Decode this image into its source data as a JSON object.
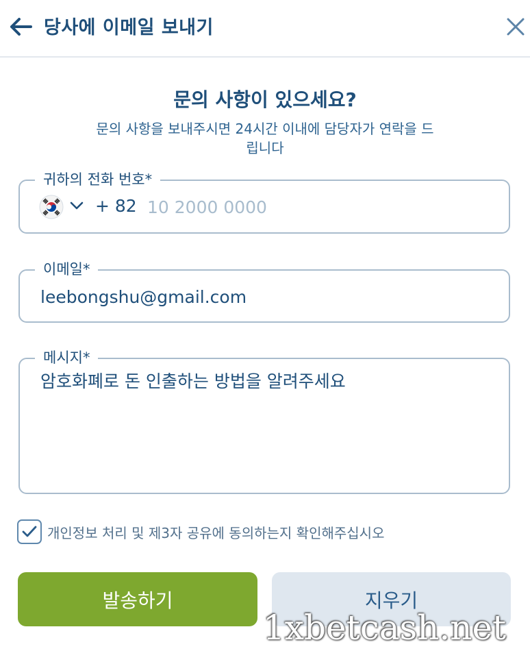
{
  "header": {
    "title": "당사에 이메일 보내기",
    "back_icon": "arrow-left-icon",
    "close_icon": "close-icon"
  },
  "intro": {
    "headline": "문의 사항이 있으세요?",
    "subtitle": "문의 사항을 보내주시면 24시간 이내에 담당자가 연락을 드립니다"
  },
  "form": {
    "phone": {
      "label": "귀하의 전화 번호*",
      "flag_icon": "south-korea-flag-icon",
      "country_code": "+ 82",
      "value": "",
      "placeholder": "10 2000 0000"
    },
    "email": {
      "label": "이메일*",
      "value": "leebongshu@gmail.com"
    },
    "message": {
      "label": "메시지*",
      "value": "암호화폐로 돈 인출하는 방법을 알려주세요"
    },
    "consent": {
      "checked": true,
      "text": "개인정보 처리 및 제3자 공유에 동의하는지 확인해주십시오"
    },
    "buttons": {
      "send_label": "발송하기",
      "clear_label": "지우기"
    }
  },
  "watermark": "1xbetcash.net",
  "colors": {
    "primary_text": "#1f4f7a",
    "send_button": "#7ea82f",
    "clear_button": "#dfe7ef",
    "border": "#a9bccd"
  }
}
